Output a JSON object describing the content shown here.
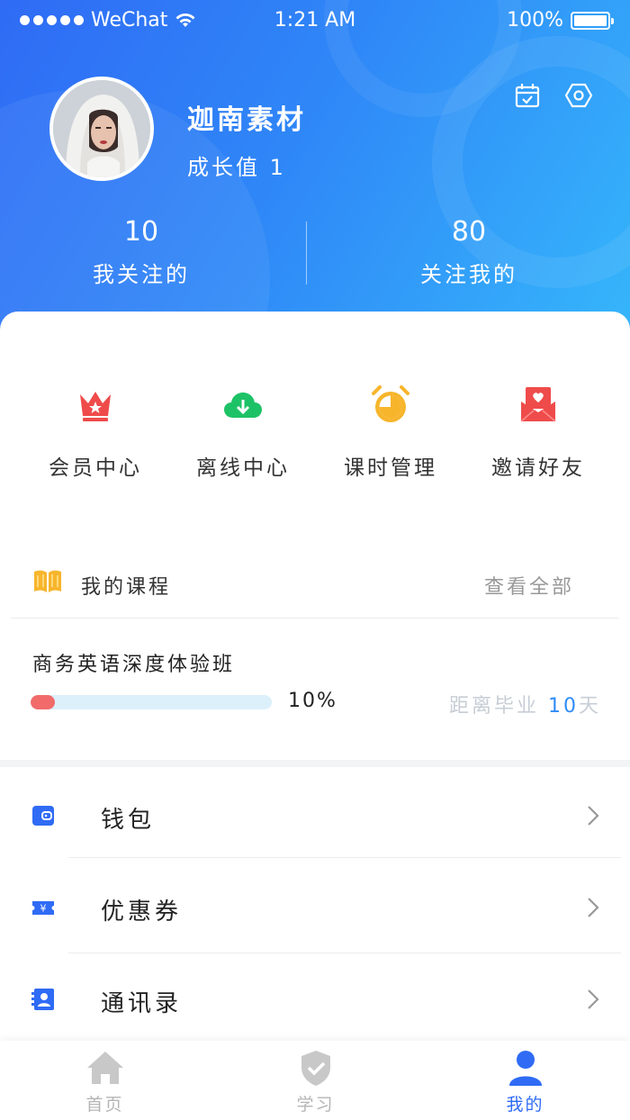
{
  "status_bar": {
    "carrier": "WeChat",
    "time": "1:21 AM",
    "battery": "100%"
  },
  "profile": {
    "username": "迦南素材",
    "growth_label": "成长值 1",
    "following_count": "10",
    "following_label": "我关注的",
    "followers_count": "80",
    "followers_label": "关注我的"
  },
  "quick_actions": [
    {
      "label": "会员中心",
      "icon": "crown-icon",
      "color": "#ef4b4b"
    },
    {
      "label": "离线中心",
      "icon": "cloud-download-icon",
      "color": "#1ec266"
    },
    {
      "label": "课时管理",
      "icon": "alarm-clock-icon",
      "color": "#f7b52c"
    },
    {
      "label": "邀请好友",
      "icon": "invite-envelope-icon",
      "color": "#ef4b4b"
    }
  ],
  "courses": {
    "title": "我的课程",
    "view_all": "查看全部",
    "course_name": "商务英语深度体验班",
    "progress_percent": 10,
    "progress_label": "10%",
    "remaining_prefix": "距离毕业",
    "remaining_days": "10",
    "remaining_suffix": "天"
  },
  "menu": [
    {
      "label": "钱包",
      "icon": "wallet-icon"
    },
    {
      "label": "优惠券",
      "icon": "coupon-icon"
    },
    {
      "label": "通讯录",
      "icon": "contacts-icon"
    }
  ],
  "tabbar": [
    {
      "label": "首页",
      "icon": "home-icon",
      "active": false
    },
    {
      "label": "学习",
      "icon": "shield-check-icon",
      "active": false
    },
    {
      "label": "我的",
      "icon": "user-icon",
      "active": true
    }
  ],
  "colors": {
    "primary": "#2f6bf5",
    "header_gradient_end": "#36b7fb",
    "progress_fill": "#f26b6b",
    "progress_track": "#dcf0fb"
  }
}
